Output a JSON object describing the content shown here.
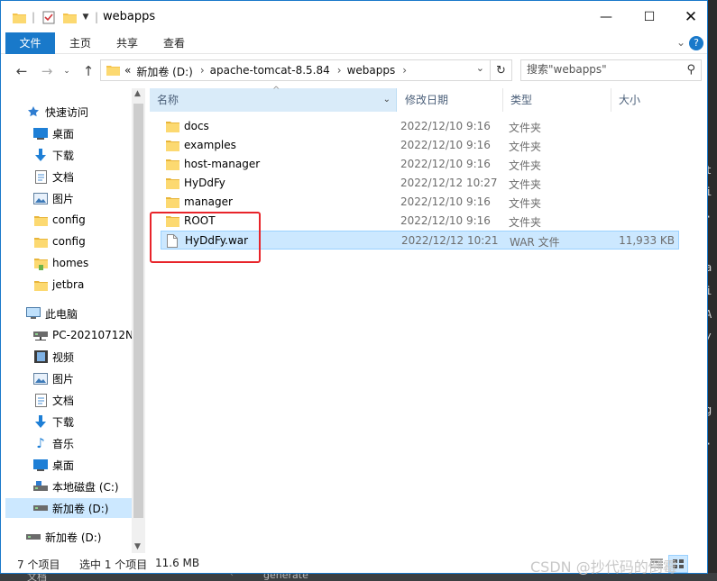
{
  "window": {
    "title": "webapps"
  },
  "ribbon": {
    "tabs": [
      "文件",
      "主页",
      "共享",
      "查看"
    ]
  },
  "address": {
    "overflow": "«",
    "crumbs": [
      "新加卷 (D:)",
      "apache-tomcat-8.5.84",
      "webapps"
    ],
    "search_placeholder": "搜索\"webapps\""
  },
  "nav": {
    "quick_access": "快速访问",
    "quick_items": [
      {
        "label": "桌面",
        "icon": "desktop-icon"
      },
      {
        "label": "下载",
        "icon": "download-icon"
      },
      {
        "label": "文档",
        "icon": "document-icon"
      },
      {
        "label": "图片",
        "icon": "pictures-icon"
      },
      {
        "label": "config",
        "icon": "folder-icon"
      },
      {
        "label": "config",
        "icon": "folder-icon"
      },
      {
        "label": "homes",
        "icon": "folder-icon"
      },
      {
        "label": "jetbra",
        "icon": "folder-icon"
      }
    ],
    "this_pc": "此电脑",
    "pc_items": [
      {
        "label": "PC-20210712N",
        "icon": "network-drive-icon"
      },
      {
        "label": "视频",
        "icon": "video-icon"
      },
      {
        "label": "图片",
        "icon": "pictures-icon"
      },
      {
        "label": "文档",
        "icon": "document-icon"
      },
      {
        "label": "下载",
        "icon": "download-icon"
      },
      {
        "label": "音乐",
        "icon": "music-icon"
      },
      {
        "label": "桌面",
        "icon": "desktop-icon"
      },
      {
        "label": "本地磁盘 (C:)",
        "icon": "drive-icon"
      },
      {
        "label": "新加卷 (D:)",
        "icon": "drive-icon"
      }
    ],
    "extra": "新加卷 (D:)"
  },
  "columns": {
    "name": "名称",
    "date": "修改日期",
    "type": "类型",
    "size": "大小"
  },
  "files": [
    {
      "name": "docs",
      "date": "2022/12/10 9:16",
      "type": "文件夹",
      "size": "",
      "icon": "folder-icon"
    },
    {
      "name": "examples",
      "date": "2022/12/10 9:16",
      "type": "文件夹",
      "size": "",
      "icon": "folder-icon"
    },
    {
      "name": "host-manager",
      "date": "2022/12/10 9:16",
      "type": "文件夹",
      "size": "",
      "icon": "folder-icon"
    },
    {
      "name": "HyDdFy",
      "date": "2022/12/12 10:27",
      "type": "文件夹",
      "size": "",
      "icon": "folder-icon"
    },
    {
      "name": "manager",
      "date": "2022/12/10 9:16",
      "type": "文件夹",
      "size": "",
      "icon": "folder-icon"
    },
    {
      "name": "ROOT",
      "date": "2022/12/10 9:16",
      "type": "文件夹",
      "size": "",
      "icon": "folder-icon"
    },
    {
      "name": "HyDdFy.war",
      "date": "2022/12/12 10:21",
      "type": "WAR 文件",
      "size": "11,933 KB",
      "icon": "file-icon"
    }
  ],
  "status": {
    "count": "7 个项目",
    "selected": "选中 1 个项目",
    "size": "11.6 MB"
  },
  "watermark": "CSDN @抄代码的倒霉",
  "background": {
    "right_glyphs": [
      "t",
      "i",
      "·",
      "a",
      "i",
      "A",
      "/",
      "g",
      "·"
    ],
    "bottom_left": "文档",
    "bottom_mid": "generate"
  }
}
